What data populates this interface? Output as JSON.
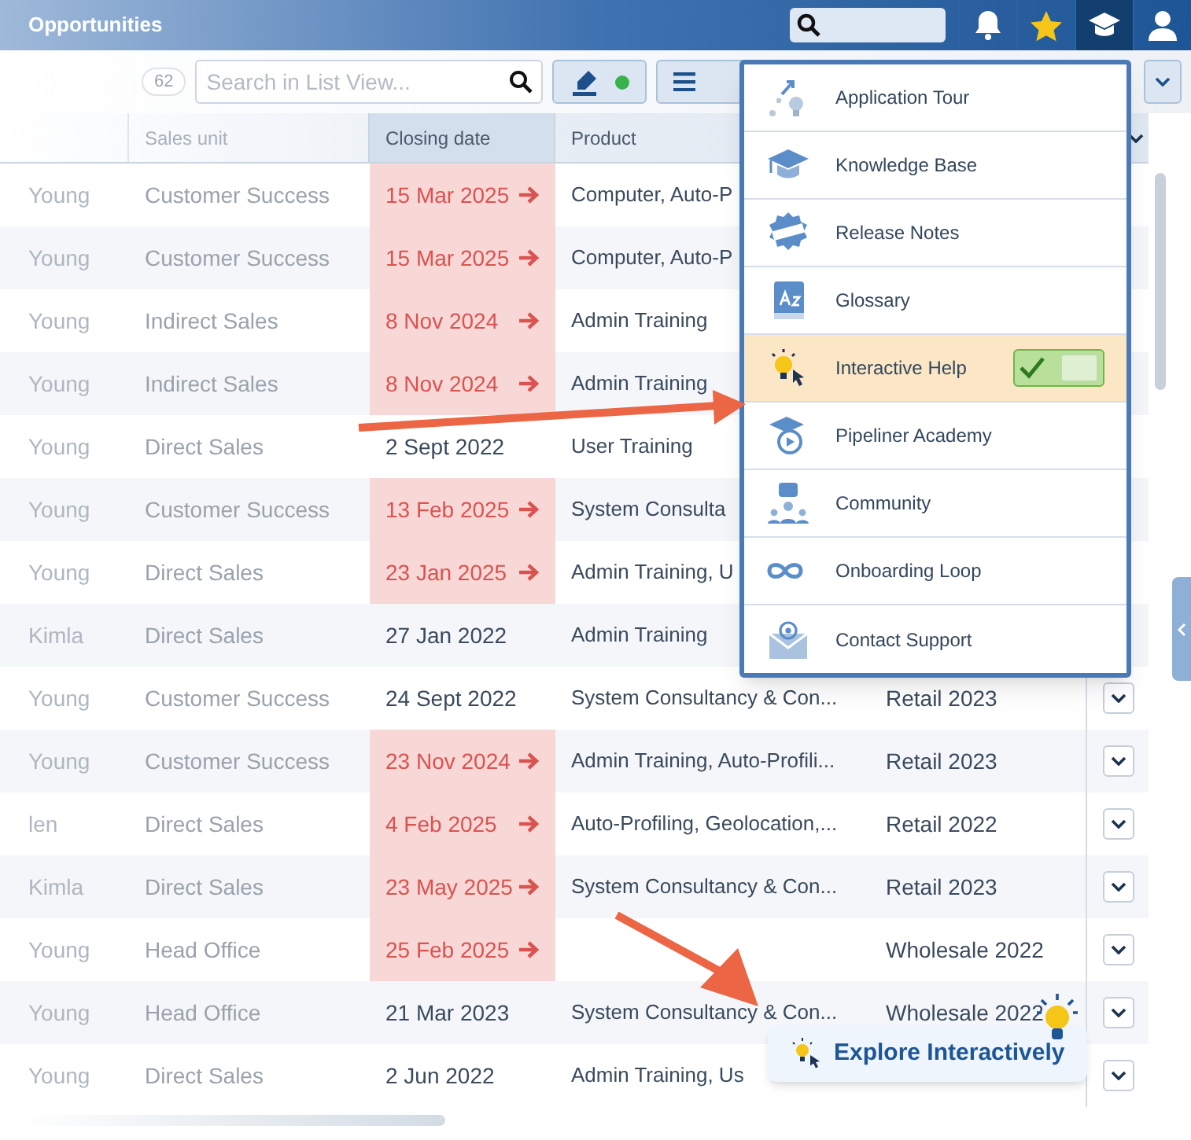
{
  "header": {
    "title": "Opportunities",
    "nav_buttons": [
      {
        "kind": "search"
      },
      {
        "kind": "bell",
        "selected": false
      },
      {
        "kind": "star",
        "selected": false
      },
      {
        "kind": "cap",
        "selected": true
      },
      {
        "kind": "user",
        "selected": false
      }
    ]
  },
  "toolbar": {
    "count": "62",
    "search": {
      "placeholder": "Search in List View..."
    }
  },
  "table": {
    "columns": [
      {
        "label": "Sales unit",
        "sorted": false
      },
      {
        "label": "Closing date",
        "sorted": true
      },
      {
        "label": "Product",
        "sorted": false
      }
    ],
    "rows": [
      {
        "owner": "Young",
        "sales_unit": "Customer Success",
        "closing_date": "15 Mar 2025",
        "overdue": true,
        "product": "Computer, Auto-P",
        "row_menu": false
      },
      {
        "owner": "Young",
        "sales_unit": "Customer Success",
        "closing_date": "15 Mar 2025",
        "overdue": true,
        "product": "Computer, Auto-P",
        "row_menu": false
      },
      {
        "owner": "Young",
        "sales_unit": "Indirect Sales",
        "closing_date": "8 Nov 2024",
        "overdue": true,
        "product": "Admin Training",
        "row_menu": false
      },
      {
        "owner": "Young",
        "sales_unit": "Indirect Sales",
        "closing_date": "8 Nov 2024",
        "overdue": true,
        "product": "Admin Training",
        "row_menu": false
      },
      {
        "owner": "Young",
        "sales_unit": "Direct Sales",
        "closing_date": "2 Sept 2022",
        "overdue": false,
        "product": "User Training",
        "row_menu": false
      },
      {
        "owner": "Young",
        "sales_unit": "Customer Success",
        "closing_date": "13 Feb 2025",
        "overdue": true,
        "product": "System Consulta",
        "row_menu": false
      },
      {
        "owner": "Young",
        "sales_unit": "Direct Sales",
        "closing_date": "23 Jan 2025",
        "overdue": true,
        "product": "Admin Training, U",
        "row_menu": false
      },
      {
        "owner": "Kimla",
        "sales_unit": "Direct Sales",
        "closing_date": "27 Jan 2022",
        "overdue": false,
        "product": "Admin Training",
        "row_menu": false
      },
      {
        "owner": "Young",
        "sales_unit": "Customer Success",
        "closing_date": "24 Sept 2022",
        "overdue": false,
        "product": "System Consultancy & Con...",
        "column_5": "Retail 2023",
        "row_menu": true
      },
      {
        "owner": "Young",
        "sales_unit": "Customer Success",
        "closing_date": "23 Nov 2024",
        "overdue": true,
        "product": "Admin Training, Auto-Profili...",
        "column_5": "Retail 2023",
        "row_menu": true
      },
      {
        "owner": "len",
        "sales_unit": "Direct Sales",
        "closing_date": "4 Feb 2025",
        "overdue": true,
        "product": "Auto-Profiling, Geolocation,...",
        "column_5": "Retail 2022",
        "row_menu": true
      },
      {
        "owner": "Kimla",
        "sales_unit": "Direct Sales",
        "closing_date": "23 May 2025",
        "overdue": true,
        "product": "System Consultancy & Con...",
        "column_5": "Retail 2023",
        "row_menu": true
      },
      {
        "owner": "Young",
        "sales_unit": "Head Office",
        "closing_date": "25 Feb 2025",
        "overdue": true,
        "column_5": "Wholesale 2022",
        "row_menu": true
      },
      {
        "owner": "Young",
        "sales_unit": "Head Office",
        "closing_date": "21 Mar 2023",
        "overdue": false,
        "product": "System Consultancy & Con...",
        "column_5": "Wholesale 2022",
        "row_menu": true
      },
      {
        "owner": "Young",
        "sales_unit": "Direct Sales",
        "closing_date": "2 Jun 2022",
        "overdue": false,
        "product": "Admin Training, Us",
        "row_menu": true
      }
    ]
  },
  "help_menu": {
    "items": [
      {
        "kind": "tour",
        "label": "Application Tour",
        "selected": false
      },
      {
        "kind": "cap",
        "label": "Knowledge Base",
        "selected": false
      },
      {
        "kind": "new",
        "label": "Release Notes",
        "selected": false
      },
      {
        "kind": "book",
        "label": "Glossary",
        "selected": false
      },
      {
        "kind": "bulb",
        "label": "Interactive Help",
        "selected": true,
        "toggle": {
          "on": true
        }
      },
      {
        "kind": "academy",
        "label": "Pipeliner Academy",
        "selected": false
      },
      {
        "kind": "community",
        "label": "Community",
        "selected": false
      },
      {
        "kind": "loop",
        "label": "Onboarding Loop",
        "selected": false
      },
      {
        "kind": "mail",
        "label": "Contact Support",
        "selected": false
      }
    ]
  },
  "callout": {
    "label": "Explore Interactively"
  }
}
